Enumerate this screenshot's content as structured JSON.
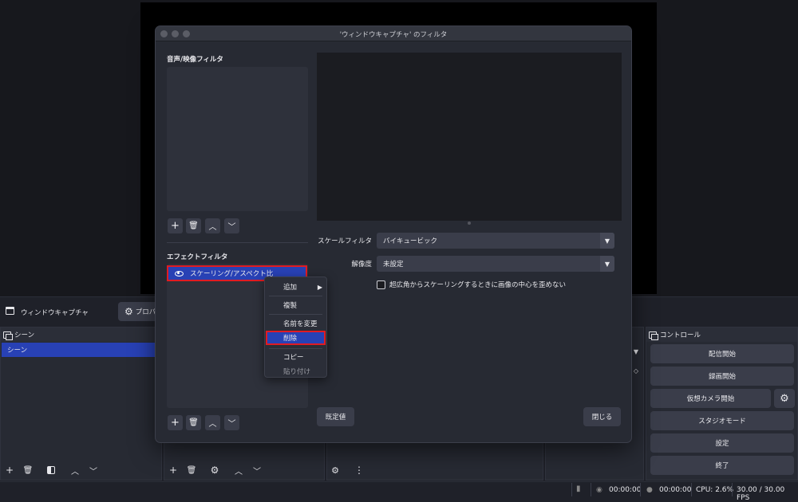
{
  "main": {
    "source_name": "ウィンドウキャプチャ",
    "properties_label": "プロパ",
    "docks": {
      "scenes_title": "シーン",
      "scene_item": "シーン",
      "controls_title": "コントロール"
    },
    "controls": [
      "配信開始",
      "録画開始",
      "仮想カメラ開始",
      "スタジオモード",
      "設定",
      "終了"
    ]
  },
  "status": {
    "stream_time": "00:00:00",
    "record_time": "00:00:00",
    "cpu": "CPU: 2.6%",
    "fps": "30.00 / 30.00 FPS"
  },
  "dialog": {
    "title": "'ウィンドウキャプチャ' のフィルタ",
    "audio_video_label": "音声/映像フィルタ",
    "effect_label": "エフェクトフィルタ",
    "effect_item": "スケーリング/アスペクト比",
    "scale_filter_label": "スケールフィルタ",
    "scale_filter_value": "バイキュービック",
    "resolution_label": "解像度",
    "resolution_value": "未設定",
    "checkbox_label": "超広角からスケーリングするときに画像の中心を歪めない",
    "defaults_button": "既定値",
    "close_button": "閉じる"
  },
  "context_menu": {
    "add": "追加",
    "duplicate": "複製",
    "rename": "名前を変更",
    "delete": "削除",
    "copy": "コピー",
    "paste": "貼り付け"
  },
  "colors": {
    "selection": "#2841b5",
    "highlight_box": "#e11b22"
  }
}
